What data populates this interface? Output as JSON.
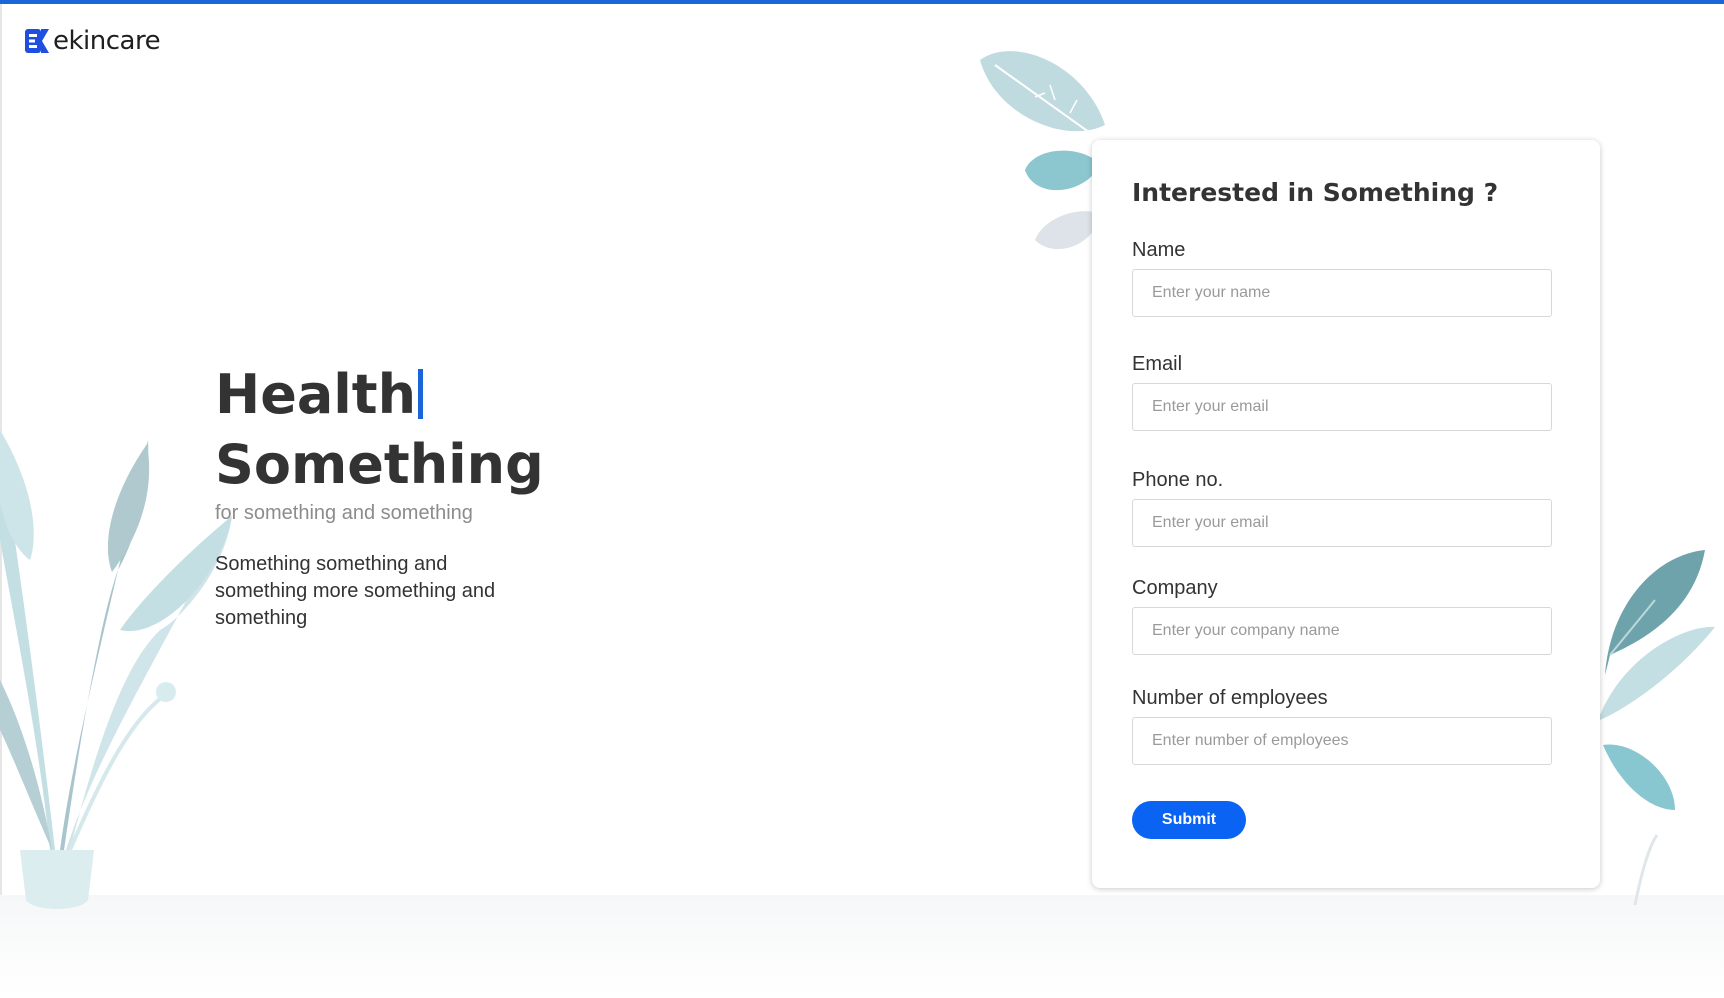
{
  "brand": {
    "name": "ekincare",
    "accent_color": "#1a66d9",
    "button_color": "#0a63f2"
  },
  "hero": {
    "headline_line1": "Health",
    "headline_line2": "Something",
    "subheadline": "for something and something",
    "description": "Something something and something more something and something"
  },
  "form": {
    "title": "Interested in Something ?",
    "fields": [
      {
        "label": "Name",
        "placeholder": "Enter your name"
      },
      {
        "label": "Email",
        "placeholder": "Enter your email"
      },
      {
        "label": "Phone no.",
        "placeholder": "Enter your email"
      },
      {
        "label": "Company",
        "placeholder": "Enter your company name"
      },
      {
        "label": "Number of employees",
        "placeholder": "Enter number of employees"
      }
    ],
    "submit_label": "Submit"
  },
  "icons": {
    "logo": "ekincare-logo-icon",
    "decor": "plant-leaves"
  }
}
